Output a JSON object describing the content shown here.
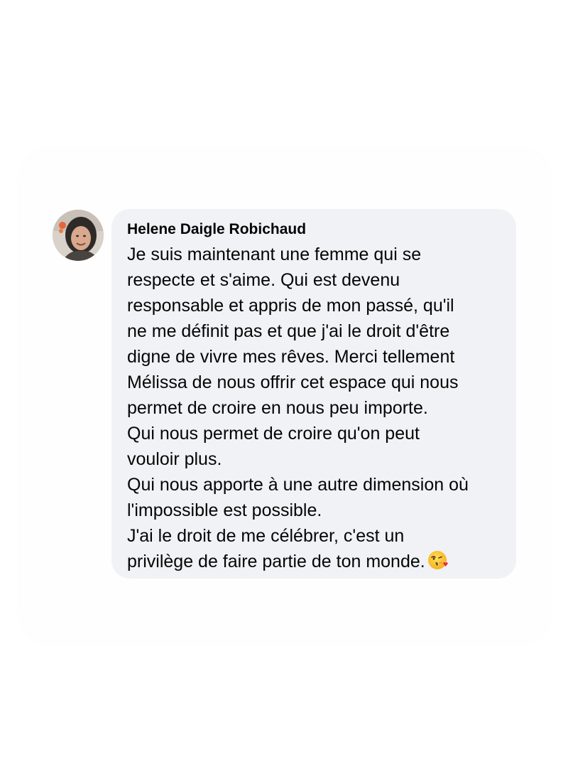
{
  "comment": {
    "author": "Helene Daigle Robichaud",
    "lines": [
      "Je suis maintenant une femme qui se",
      "respecte et s'aime. Qui est devenu",
      "responsable et appris de mon passé, qu'il",
      "ne me définit pas et que j'ai le droit d'être",
      "digne de vivre mes rêves. Merci tellement",
      "Mélissa de nous offrir cet espace qui nous",
      "permet de croire en nous peu importe.",
      "Qui nous permet de croire qu'on peut",
      "vouloir plus.",
      "Qui nous apporte à une autre dimension où",
      "l'impossible est possible.",
      "J'ai le droit de me célébrer, c'est un",
      "privilège de faire partie de ton monde."
    ],
    "trailing_emoji": "kissing-face-with-heart-emoji"
  },
  "colors": {
    "bubble_background": "#f0f2f5",
    "text": "#050505",
    "page_background": "#ffffff"
  }
}
